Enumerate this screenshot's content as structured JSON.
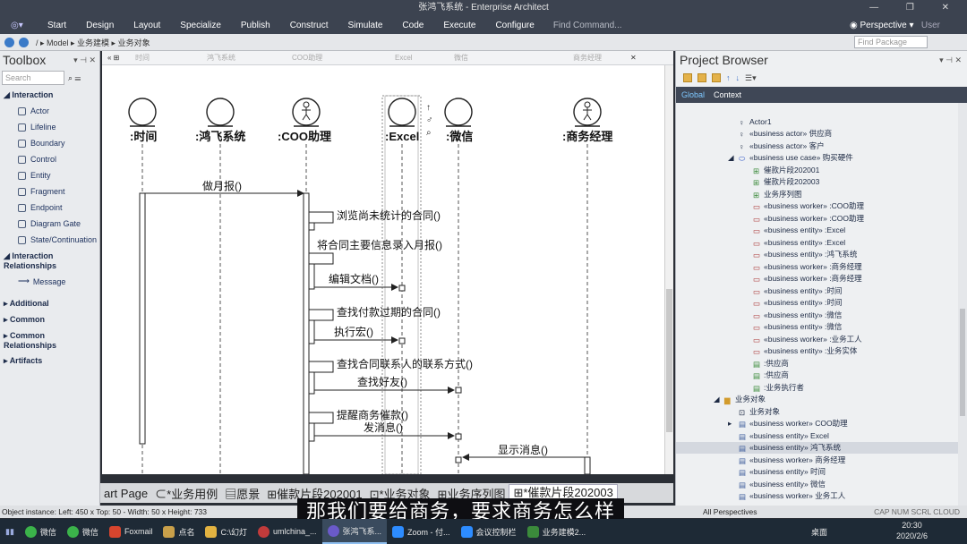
{
  "window": {
    "title": "张鸿飞系统 - Enterprise Architect",
    "controls": "— ❐ ✕"
  },
  "ribbon": {
    "menus": [
      "Start",
      "Design",
      "Layout",
      "Specialize",
      "Publish",
      "Construct",
      "Simulate",
      "Code",
      "Execute",
      "Configure"
    ],
    "find_command": "Find Command...",
    "perspective": "Perspective",
    "user": "User"
  },
  "navbar": {
    "breadcrumb": "/ ▸ Model ▸ 业务建模 ▸ 业务对象",
    "find_package_placeholder": "Find Package"
  },
  "toolbox": {
    "title": "Toolbox",
    "search_placeholder": "Search",
    "groups": [
      {
        "name": "Interaction",
        "items": [
          "Actor",
          "Lifeline",
          "Boundary",
          "Control",
          "Entity",
          "Fragment",
          "Endpoint",
          "Diagram Gate",
          "State/Continuation"
        ]
      },
      {
        "name": "Interaction Relationships",
        "items": [
          "Message"
        ]
      }
    ],
    "collapsed": [
      "Additional",
      "Common",
      "Common Relationships",
      "Artifacts"
    ]
  },
  "diagram": {
    "header_lifelines": [
      "时间",
      "鸿飞系统",
      "COO助理",
      "Excel",
      "微信",
      "商务经理"
    ],
    "lifelines": [
      ":时间",
      ":鸿飞系统",
      ":COO助理",
      ":Excel",
      ":微信",
      ":商务经理"
    ],
    "messages": [
      "做月报()",
      "浏览尚未统计的合同()",
      "将合同主要信息录入月报()",
      "编辑文档()",
      "查找付款过期的合同()",
      "执行宏()",
      "查找合同联系人的联系方式()",
      "查找好友()",
      "提醒商务催款()",
      "发消息()",
      "显示消息()"
    ]
  },
  "tabs": [
    "art Page",
    "*业务用例",
    "愿景",
    "催款片段202001",
    "*业务对象",
    "业务序列图",
    "*催款片段202003"
  ],
  "project_browser": {
    "title": "Project Browser",
    "scope_tabs": [
      "Global",
      "Context"
    ],
    "tree": [
      "Actor1",
      "«business actor» 供应商",
      "«business actor» 客户",
      "«business use case» 购买硬件",
      "催款片段202001",
      "催款片段202003",
      "业务序列图",
      "«business worker» :COO助理",
      "«business worker» :COO助理",
      "«business entity» :Excel",
      "«business entity» :Excel",
      "«business entity» :鸿飞系统",
      "«business worker» :商务经理",
      "«business worker» :商务经理",
      "«business entity» :时间",
      "«business entity» :时间",
      "«business entity» :微信",
      "«business entity» :微信",
      "«business worker» :业务工人",
      "«business entity» :业务实体",
      ":供应商",
      ":供应商",
      ":业务执行者",
      "业务对象",
      "业务对象",
      "«business worker» COO助理",
      "«business entity» Excel",
      "«business entity» 鸿飞系统",
      "«business worker» 商务经理",
      "«business entity» 时间",
      "«business entity» 微信",
      "«business worker» 业务工人"
    ]
  },
  "statusbar": {
    "text": "Object instance:  Left:   450 x Top:   50 - Width:   50 x Height:   733",
    "perspective": "All Perspectives",
    "indicators": "CAP   NUM   SCRL   CLOUD"
  },
  "taskbar": {
    "items": [
      "微信",
      "微信",
      "Foxmail",
      "点名",
      "C:\\幻灯",
      "umlchina_...",
      "张鸿飞系...",
      "Zoom - 付...",
      "会议控制栏",
      "业务建模2..."
    ],
    "desktop": "桌面",
    "time": "20:30",
    "date": "2020/2/6"
  },
  "subtitle": "那我们要给商务，要求商务怎么样"
}
